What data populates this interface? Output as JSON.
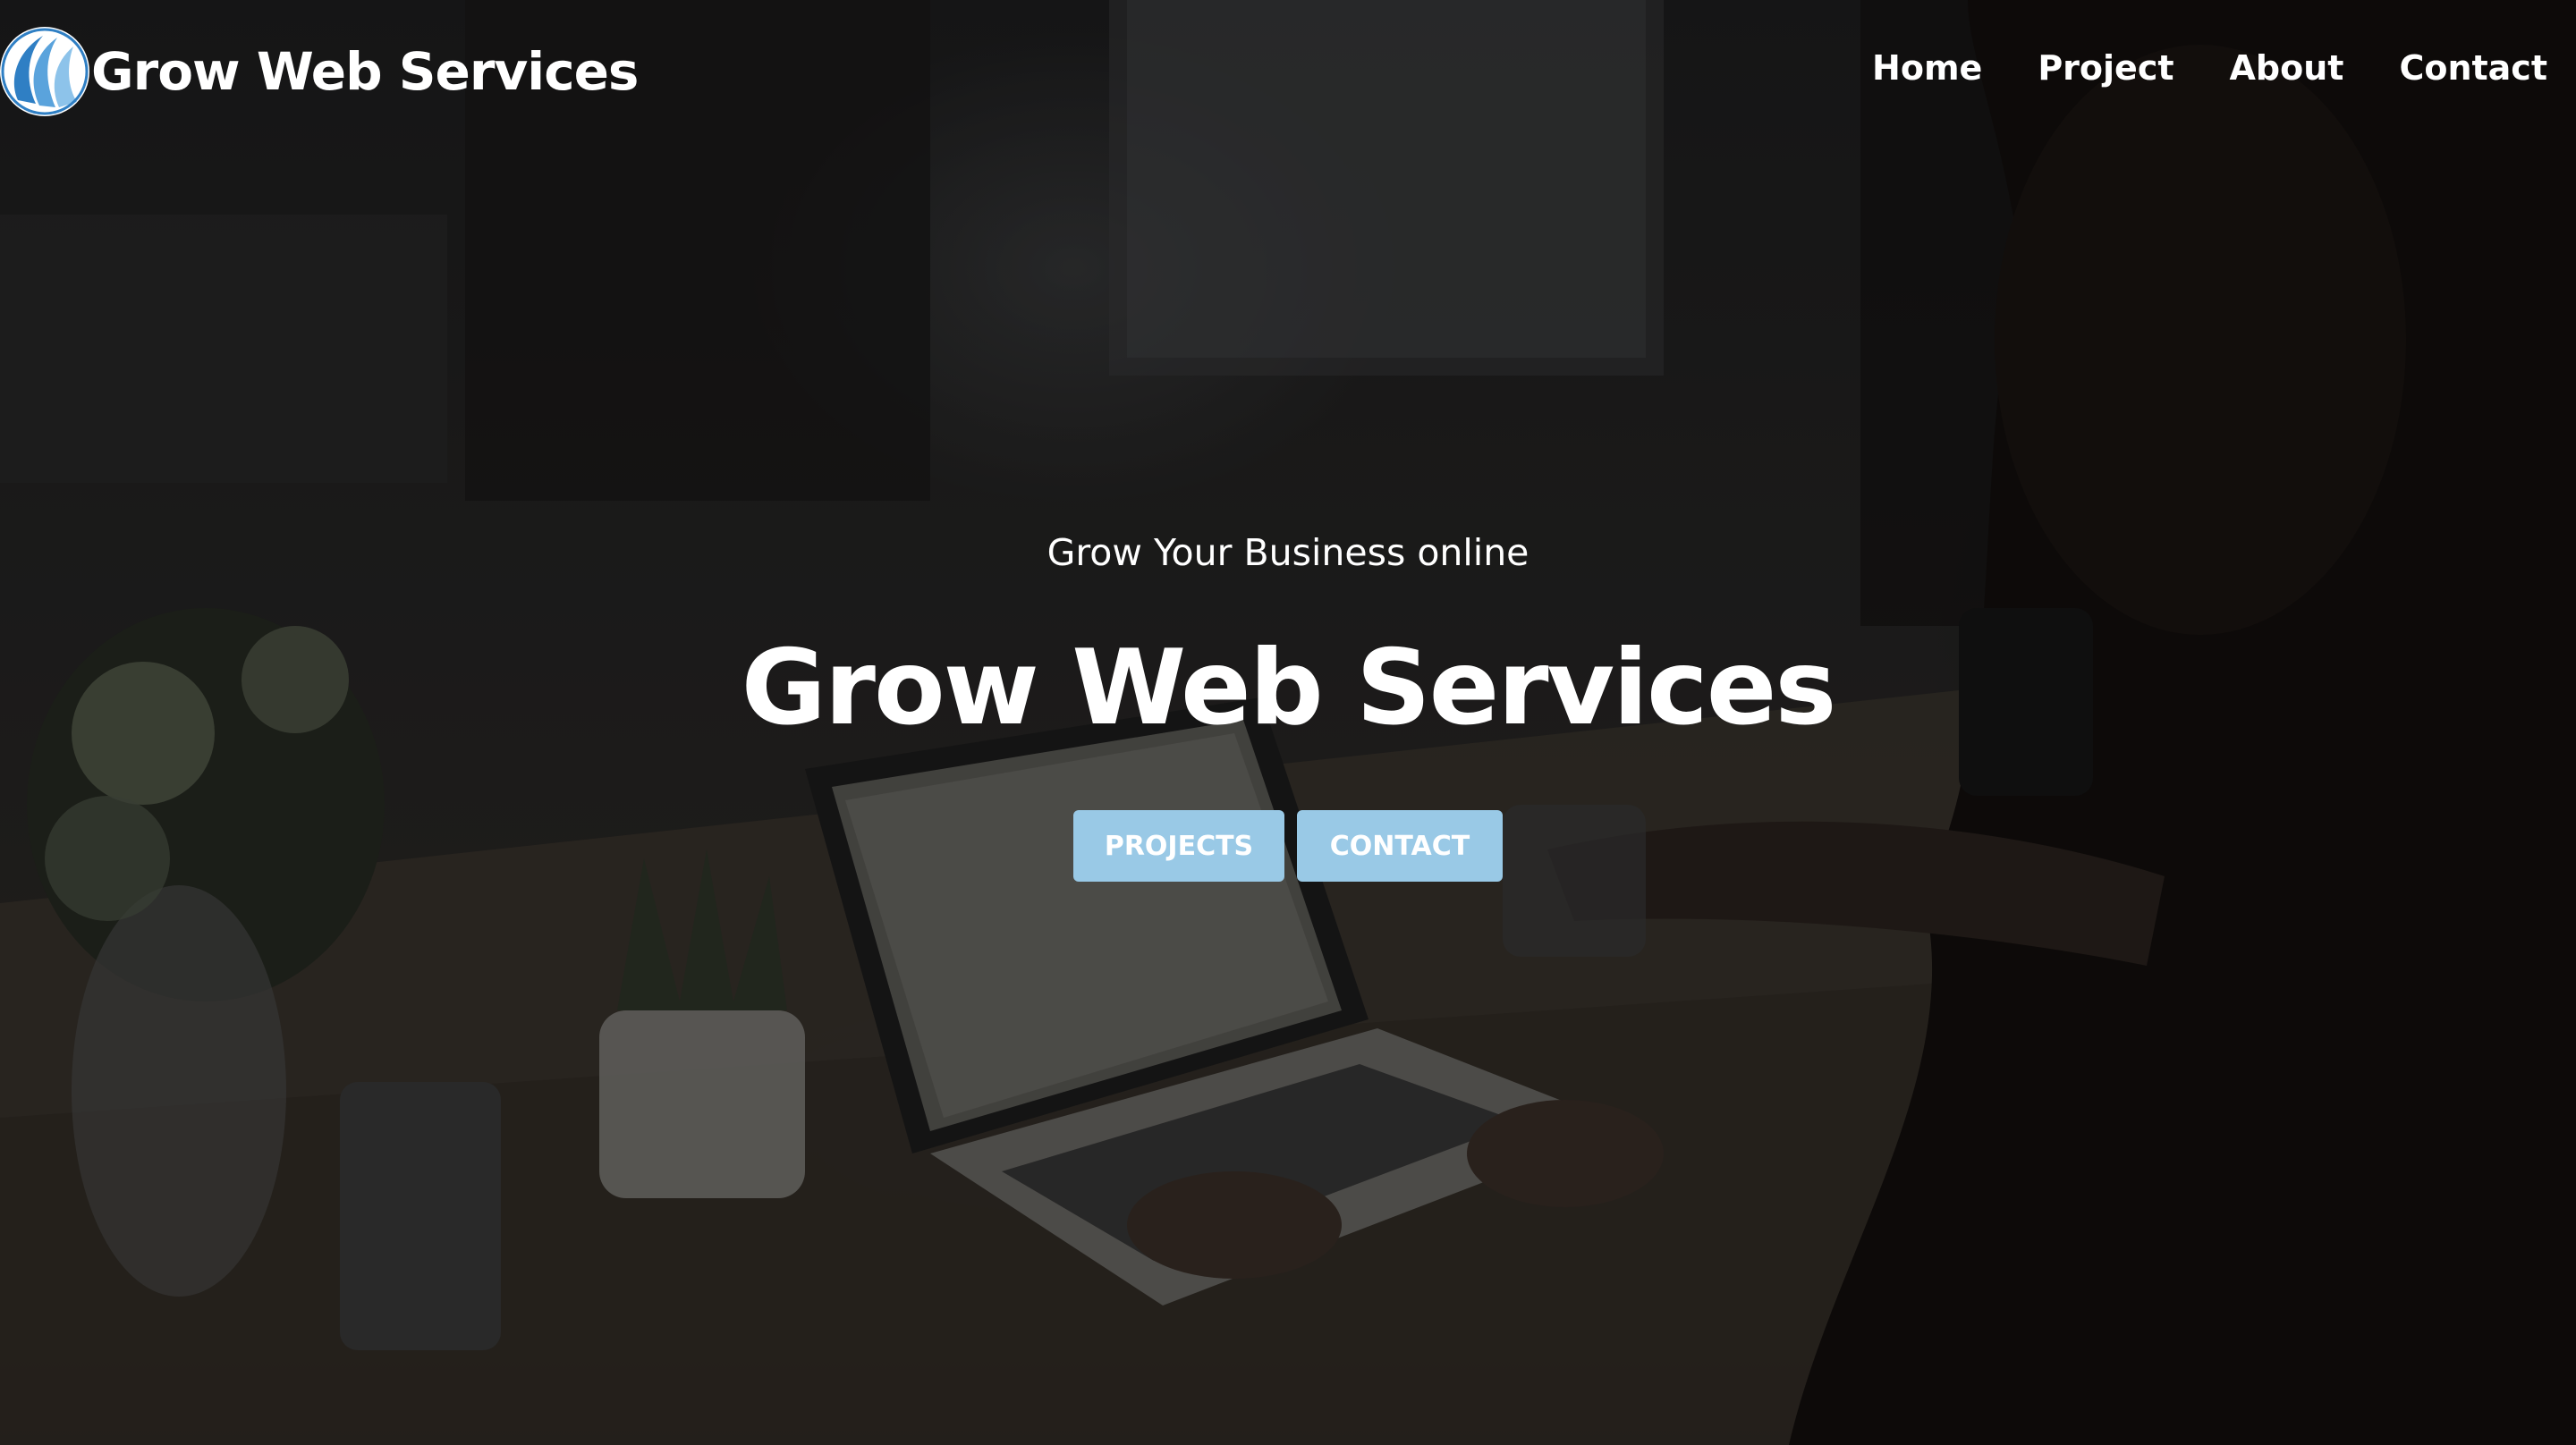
{
  "brand": {
    "name": "Grow Web Services",
    "logo_icon": "wave-logo-icon"
  },
  "nav": {
    "items": [
      {
        "label": "Home"
      },
      {
        "label": "Project"
      },
      {
        "label": "About"
      },
      {
        "label": "Contact"
      }
    ]
  },
  "hero": {
    "tagline": "Grow Your Business online",
    "title": "Grow Web Services",
    "buttons": {
      "projects_label": "PROJECTS",
      "contact_label": "CONTACT"
    }
  },
  "colors": {
    "accent": "#99c9e6",
    "text": "#ffffff",
    "logo_blue": "#3f8fd0"
  }
}
